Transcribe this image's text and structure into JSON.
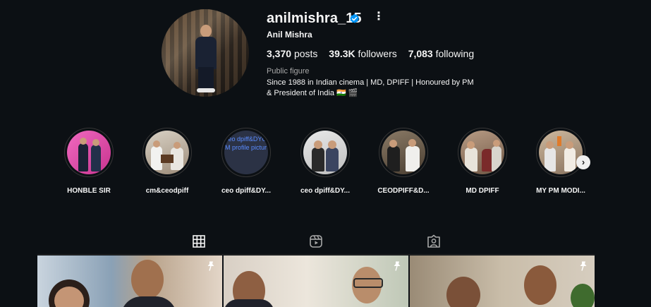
{
  "profile": {
    "username": "anilmishra_15",
    "full_name": "Anil Mishra",
    "stats": {
      "posts_count": "3,370",
      "posts_label": "posts",
      "followers_count": "39.3K",
      "followers_label": "followers",
      "following_count": "7,083",
      "following_label": "following"
    },
    "category": "Public figure",
    "bio_line1": "Since 1988 in Indian cinema | MD, DPIFF | Honoured by PM",
    "bio_line2": "& President of India 🇮🇳 🎬",
    "more_glyph": "⋮"
  },
  "highlights": [
    {
      "label": "HONBLE SIR"
    },
    {
      "label": "cm&ceodpiff"
    },
    {
      "label": "ceo dpiff&DY...",
      "cover_text": "ceo dpiff&DYCM profile pictur"
    },
    {
      "label": "ceo dpiff&DY..."
    },
    {
      "label": "CEODPIFF&D..."
    },
    {
      "label": "MD DPIFF"
    },
    {
      "label": "MY PM MODI..."
    }
  ],
  "highlights_next": "›",
  "tabs": [
    "posts-grid",
    "reels",
    "tagged"
  ],
  "colors": {
    "background": "#0c1014",
    "verified": "#0095f6",
    "secondary_text": "#a8a8a8"
  }
}
